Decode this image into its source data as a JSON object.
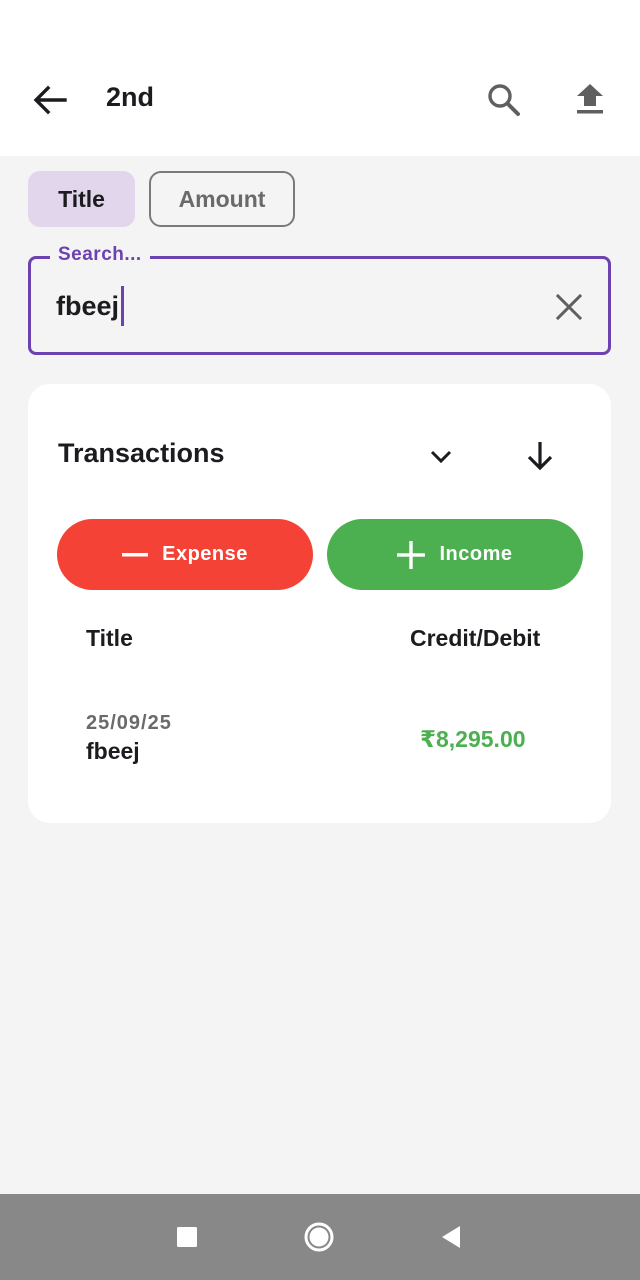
{
  "appbar": {
    "title": "2nd",
    "back_icon": "arrow-left-icon",
    "search_icon": "search-icon",
    "upload_icon": "upload-icon"
  },
  "filters": {
    "items": [
      {
        "label": "Title",
        "selected": true
      },
      {
        "label": "Amount",
        "selected": false
      }
    ]
  },
  "search": {
    "label": "Search...",
    "value": "fbeej",
    "clear_icon": "close-icon"
  },
  "transactions": {
    "title": "Transactions",
    "expand_icon": "chevron-down-icon",
    "sort_icon": "arrow-down-icon",
    "expense_label": "Expense",
    "income_label": "Income",
    "columns": {
      "title": "Title",
      "credit_debit": "Credit/Debit"
    },
    "rows": [
      {
        "date": "25/09/25",
        "name": "fbeej",
        "amount": "₹8,295.00",
        "type": "credit"
      }
    ]
  },
  "colors": {
    "accent": "#6b42b0",
    "chip_selected": "#e1d6ec",
    "expense": "#f44336",
    "income": "#4caf50",
    "background": "#f4f4f4",
    "navbar": "#888888"
  },
  "navbar": {
    "recents_icon": "square-icon",
    "home_icon": "circle-icon",
    "back_icon": "triangle-back-icon"
  }
}
